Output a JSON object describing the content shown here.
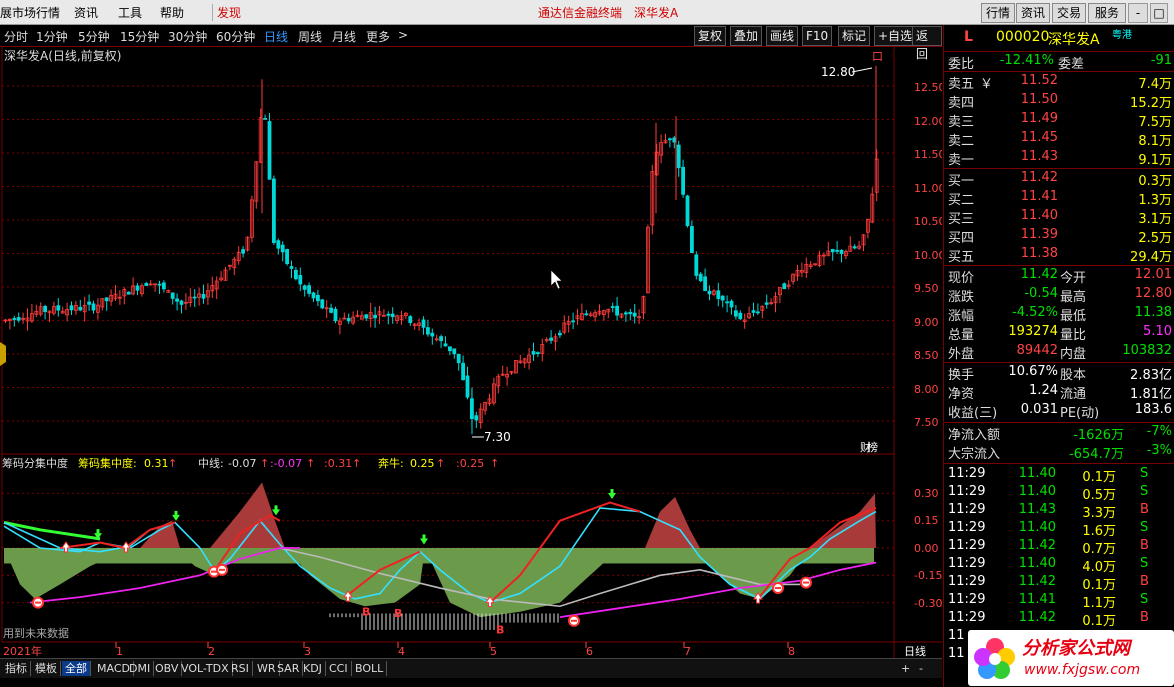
{
  "menubar": {
    "items": [
      "展市场行情",
      "资讯",
      "工具",
      "帮助"
    ],
    "discover": "发现",
    "center_link1": "通达信金融终端",
    "center_link2": "深华发A",
    "right_buttons": [
      "行情",
      "资讯",
      "交易",
      "服务"
    ],
    "window_controls": [
      "-",
      "□",
      "×"
    ]
  },
  "periodbar": {
    "periods": [
      "分时",
      "1分钟",
      "5分钟",
      "15分钟",
      "30分钟",
      "60分钟",
      "日线",
      "周线",
      "月线",
      "更多"
    ],
    "active": "日线",
    "more_arrow": ">",
    "tools": [
      "复权",
      "叠加",
      "画线",
      "F10",
      "标记",
      "+自选",
      "返回"
    ]
  },
  "chart": {
    "title": "深华发A(日线,前复权)",
    "price_axis": [
      "12.50",
      "12.00",
      "11.50",
      "11.00",
      "10.50",
      "10.00",
      "9.50",
      "9.00",
      "8.50",
      "8.00",
      "7.50"
    ],
    "high_label": "12.80",
    "low_label": "7.30",
    "badge": "财",
    "badge2": "榜",
    "corner_icon": "口",
    "indicator_name": "筹码分集中度",
    "ind_label1": "筹码集中度:",
    "ind_val1": "0.31",
    "ind_label2": "中线:",
    "ind_val2": "-0.07",
    "ind_val3": ":-0.07",
    "ind_val4": ":0.31",
    "ind_label5": "奔牛:",
    "ind_val5": "0.25",
    "ind_val6": ":0.25",
    "ind_axis": [
      "0.30",
      "0.15",
      "0.00",
      "-0.15",
      "-0.30"
    ],
    "future_data_note": "用到未来数据",
    "date_year": "2021年",
    "month_marks": [
      "1",
      "2",
      "3",
      "4",
      "5",
      "6",
      "7",
      "8"
    ],
    "period_label": "日线",
    "zoom_plus": "+",
    "zoom_minus": "-",
    "marker_b": "B"
  },
  "tabs": [
    "指标",
    "模板",
    "全部",
    "MACD",
    "DMI",
    "OBV",
    "VOL-TDX",
    "RSI",
    "WR",
    "SAR",
    "KDJ",
    "CCI",
    "BOLL"
  ],
  "active_tab": "全部",
  "panel": {
    "l_mark": "L",
    "code": "000020",
    "name": "深华发A",
    "hk_tag": "粤港",
    "weibi_label": "委比",
    "weibi_val": "-12.41%",
    "weicha_label": "委差",
    "weicha_val": "-91",
    "sells": [
      {
        "label": "卖五",
        "price": "11.52",
        "vol": "7.4万"
      },
      {
        "label": "卖四",
        "price": "11.50",
        "vol": "15.2万"
      },
      {
        "label": "卖三",
        "price": "11.49",
        "vol": "7.5万"
      },
      {
        "label": "卖二",
        "price": "11.45",
        "vol": "8.1万"
      },
      {
        "label": "卖一",
        "price": "11.43",
        "vol": "9.1万"
      }
    ],
    "yen": "￥",
    "buys": [
      {
        "label": "买一",
        "price": "11.42",
        "vol": "0.3万"
      },
      {
        "label": "买二",
        "price": "11.41",
        "vol": "1.3万"
      },
      {
        "label": "买三",
        "price": "11.40",
        "vol": "3.1万"
      },
      {
        "label": "买四",
        "price": "11.39",
        "vol": "2.5万"
      },
      {
        "label": "买五",
        "price": "11.38",
        "vol": "29.4万"
      }
    ],
    "stats": [
      {
        "l1": "现价",
        "v1": "11.42",
        "c1": "green",
        "l2": "今开",
        "v2": "12.01",
        "c2": "red"
      },
      {
        "l1": "涨跌",
        "v1": "-0.54",
        "c1": "green",
        "l2": "最高",
        "v2": "12.80",
        "c2": "red"
      },
      {
        "l1": "涨幅",
        "v1": "-4.52%",
        "c1": "green",
        "l2": "最低",
        "v2": "11.38",
        "c2": "green"
      },
      {
        "l1": "总量",
        "v1": "193274",
        "c1": "yellow",
        "l2": "量比",
        "v2": "5.10",
        "c2": "mag"
      },
      {
        "l1": "外盘",
        "v1": "89442",
        "c1": "red",
        "l2": "内盘",
        "v2": "103832",
        "c2": "green"
      }
    ],
    "fund": [
      {
        "l1": "换手",
        "v1": "10.67%",
        "l2": "股本",
        "v2": "2.83亿"
      },
      {
        "l1": "净资",
        "v1": "1.24",
        "l2": "流通",
        "v2": "1.81亿"
      },
      {
        "l1": "收益(三)",
        "v1": "0.031",
        "l2": "PE(动)",
        "v2": "183.6"
      }
    ],
    "flow": [
      {
        "label": "净流入额",
        "v1": "-1626万",
        "v2": "-7%"
      },
      {
        "label": "大宗流入",
        "v1": "-654.7万",
        "v2": "-3%"
      }
    ],
    "ticks": [
      {
        "t": "11:29",
        "p": "11.40",
        "v": "0.1万",
        "s": "S"
      },
      {
        "t": "11:29",
        "p": "11.40",
        "v": "0.5万",
        "s": "S"
      },
      {
        "t": "11:29",
        "p": "11.43",
        "v": "3.3万",
        "s": "B"
      },
      {
        "t": "11:29",
        "p": "11.40",
        "v": "1.6万",
        "s": "S"
      },
      {
        "t": "11:29",
        "p": "11.42",
        "v": "0.7万",
        "s": "B"
      },
      {
        "t": "11:29",
        "p": "11.40",
        "v": "4.0万",
        "s": "S"
      },
      {
        "t": "11:29",
        "p": "11.42",
        "v": "0.1万",
        "s": "B"
      },
      {
        "t": "11:29",
        "p": "11.41",
        "v": "1.1万",
        "s": "S"
      },
      {
        "t": "11:29",
        "p": "11.42",
        "v": "0.1万",
        "s": "B"
      },
      {
        "t": "11",
        "p": "",
        "v": "",
        "s": ""
      },
      {
        "t": "11",
        "p": "",
        "v": "",
        "s": ""
      }
    ],
    "watermark_brand": "分析家公式网",
    "watermark_url": "www.fxjgsw.com"
  },
  "colors": {
    "up": "#ff3c3c",
    "down": "#00d8d8",
    "grid": "#7a0000",
    "mid_line": "#bbbbbb",
    "cyan_line": "#33e0ff",
    "magenta_line": "#ee22ee",
    "green_fill": "#6b9b4a",
    "red_fill": "#a83a3a"
  }
}
